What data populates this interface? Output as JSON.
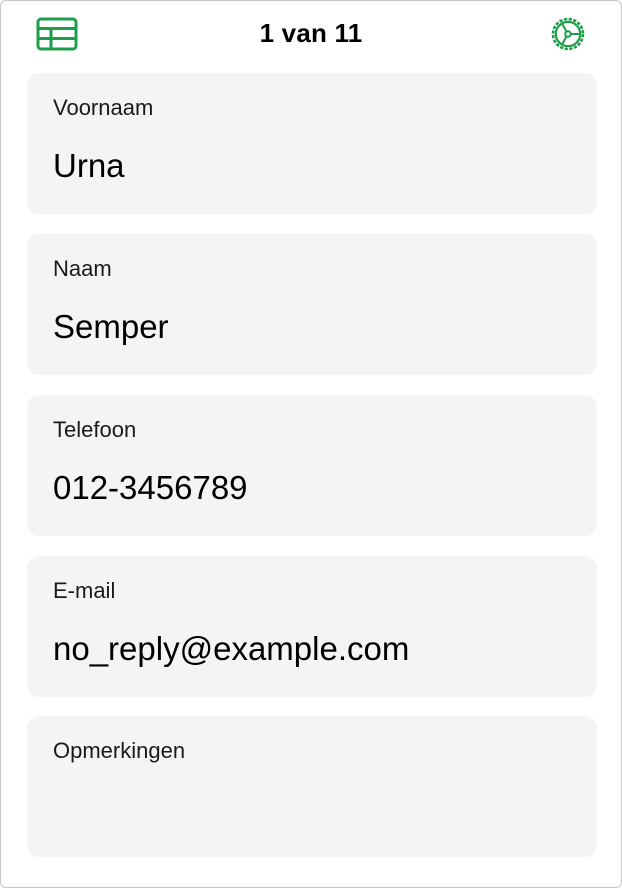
{
  "header": {
    "title": "1 van 11",
    "left_icon": "table-icon",
    "right_icon": "gear-icon",
    "accent_color": "#1e9e4a"
  },
  "fields": [
    {
      "label": "Voornaam",
      "value": "Urna"
    },
    {
      "label": "Naam",
      "value": "Semper"
    },
    {
      "label": "Telefoon",
      "value": "012-3456789"
    },
    {
      "label": "E-mail",
      "value": "no_reply@example.com"
    },
    {
      "label": "Opmerkingen",
      "value": ""
    }
  ]
}
